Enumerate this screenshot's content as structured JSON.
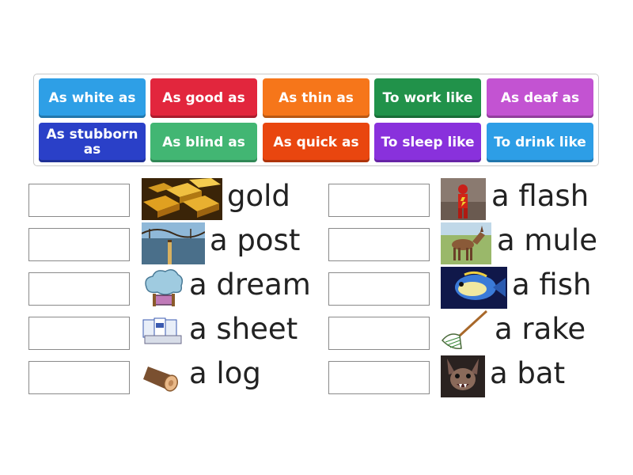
{
  "tiles": [
    {
      "label": "As white as",
      "color": "#2e9fe6"
    },
    {
      "label": "As good as",
      "color": "#e2263d"
    },
    {
      "label": "As thin as",
      "color": "#f6761a"
    },
    {
      "label": "To work like",
      "color": "#21924a"
    },
    {
      "label": "As deaf as",
      "color": "#c353d2"
    },
    {
      "label": "As stubborn as",
      "color": "#2a40c8"
    },
    {
      "label": "As blind as",
      "color": "#42b673"
    },
    {
      "label": "As quick as",
      "color": "#e9460f"
    },
    {
      "label": "To sleep like",
      "color": "#8931dc"
    },
    {
      "label": "To drink like",
      "color": "#2d9ee6"
    }
  ],
  "rows": [
    {
      "word": "gold",
      "image": "gold-bars-image"
    },
    {
      "word": "a post",
      "image": "post-image"
    },
    {
      "word": "a dream",
      "image": "dream-image"
    },
    {
      "word": "a sheet",
      "image": "paper-sheets-image"
    },
    {
      "word": "a log",
      "image": "log-image"
    },
    {
      "word": "a flash",
      "image": "flash-superhero-image"
    },
    {
      "word": "a mule",
      "image": "mule-image"
    },
    {
      "word": "a fish",
      "image": "fish-image"
    },
    {
      "word": "a rake",
      "image": "rake-image"
    },
    {
      "word": "a bat",
      "image": "bat-image"
    }
  ]
}
